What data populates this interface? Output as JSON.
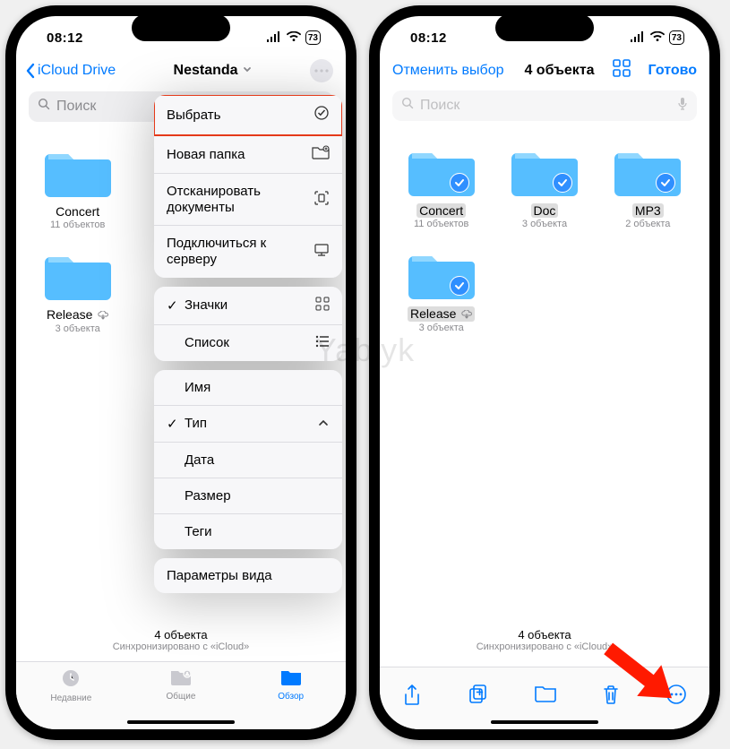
{
  "watermark": "Yablyk",
  "status": {
    "time": "08:12",
    "battery": "73"
  },
  "left": {
    "back": "iCloud Drive",
    "title": "Nestanda",
    "search_placeholder": "Поиск",
    "folders": [
      {
        "name": "Concert",
        "sub": "11 объектов"
      },
      {
        "name": "Release",
        "sub": "3 объекта",
        "cloud": true
      }
    ],
    "menu": {
      "group1": [
        {
          "key": "select",
          "label": "Выбрать",
          "icon": "select-icon",
          "highlight": true
        },
        {
          "key": "newfolder",
          "label": "Новая папка",
          "icon": "newfolder-icon"
        },
        {
          "key": "scan",
          "label": "Отсканировать",
          "label2": "документы",
          "icon": "scan-icon"
        },
        {
          "key": "connect",
          "label": "Подключиться к",
          "label2": "серверу",
          "icon": "server-icon"
        }
      ],
      "group2": [
        {
          "key": "icons",
          "label": "Значки",
          "checked": true,
          "icon": "grid-icon"
        },
        {
          "key": "list",
          "label": "Список",
          "icon": "list-icon"
        }
      ],
      "group3": [
        {
          "key": "name",
          "label": "Имя"
        },
        {
          "key": "type",
          "label": "Тип",
          "checked": true,
          "icon": "chevron-up-icon"
        },
        {
          "key": "date",
          "label": "Дата"
        },
        {
          "key": "size",
          "label": "Размер"
        },
        {
          "key": "tags",
          "label": "Теги"
        }
      ],
      "group4": [
        {
          "key": "viewopts",
          "label": "Параметры вида"
        }
      ]
    },
    "summary": {
      "line1": "4 объекта",
      "line2": "Синхронизировано с «iCloud»"
    },
    "tabs": {
      "recent": "Недавние",
      "shared": "Общие",
      "browse": "Обзор"
    }
  },
  "right": {
    "cancel": "Отменить выбор",
    "count": "4 объекта",
    "done": "Готово",
    "search_placeholder": "Поиск",
    "folders": [
      {
        "name": "Concert",
        "sub": "11 объектов"
      },
      {
        "name": "Doc",
        "sub": "3 объекта"
      },
      {
        "name": "MP3",
        "sub": "2 объекта"
      },
      {
        "name": "Release",
        "sub": "3 объекта",
        "cloud": true
      }
    ],
    "summary": {
      "line1": "4 объекта",
      "line2": "Синхронизировано с «iCloud»"
    }
  }
}
